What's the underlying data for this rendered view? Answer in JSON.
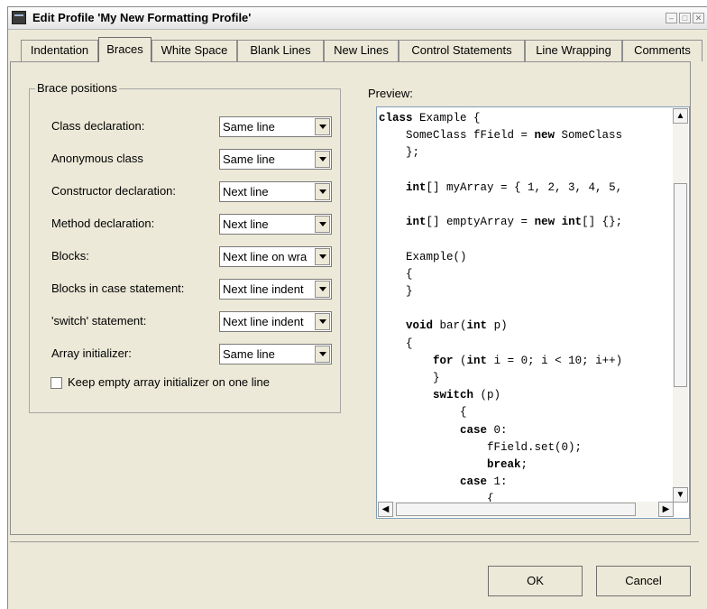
{
  "window": {
    "title": "Edit Profile 'My New Formatting Profile'"
  },
  "tabs": [
    {
      "label": "Indentation",
      "active": false
    },
    {
      "label": "Braces",
      "active": true
    },
    {
      "label": "White Space",
      "active": false
    },
    {
      "label": "Blank Lines",
      "active": false
    },
    {
      "label": "New Lines",
      "active": false
    },
    {
      "label": "Control Statements",
      "active": false
    },
    {
      "label": "Line Wrapping",
      "active": false
    },
    {
      "label": "Comments",
      "active": false
    }
  ],
  "brace_positions": {
    "legend": "Brace positions",
    "rows": [
      {
        "label": "Class declaration:",
        "value": "Same line"
      },
      {
        "label": "Anonymous class",
        "value": "Same line"
      },
      {
        "label": "Constructor declaration:",
        "value": "Next line"
      },
      {
        "label": "Method declaration:",
        "value": "Next line"
      },
      {
        "label": "Blocks:",
        "value": "Next line on wra"
      },
      {
        "label": "Blocks in case statement:",
        "value": "Next line indent"
      },
      {
        "label": "'switch' statement:",
        "value": "Next line indent"
      },
      {
        "label": "Array initializer:",
        "value": "Same line"
      }
    ],
    "keep_empty_label": "Keep empty array initializer on one line",
    "keep_empty_checked": false
  },
  "preview": {
    "label": "Preview:",
    "lines": [
      "class Example {",
      "    SomeClass fField = new SomeClass",
      "    };",
      "",
      "    int[] myArray = { 1, 2, 3, 4, 5,",
      "",
      "    int[] emptyArray = new int[] {};",
      "",
      "    Example()",
      "    {",
      "    }",
      "",
      "    void bar(int p)",
      "    {",
      "        for (int i = 0; i < 10; i++)",
      "        }",
      "        switch (p)",
      "            {",
      "            case 0:",
      "                fField.set(0);",
      "                break;",
      "            case 1:",
      "                {"
    ]
  },
  "buttons": {
    "ok": "OK",
    "cancel": "Cancel"
  }
}
